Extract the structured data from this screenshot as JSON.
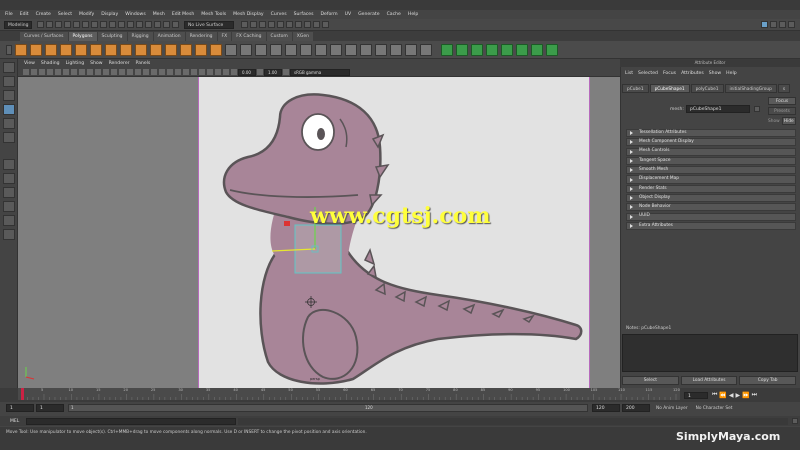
{
  "menubar": {
    "items": [
      "File",
      "Edit",
      "Create",
      "Select",
      "Modify",
      "Display",
      "Windows",
      "Mesh",
      "Edit Mesh",
      "Mesh Tools",
      "Mesh Display",
      "Curves",
      "Surfaces",
      "Deform",
      "UV",
      "Generate",
      "Cache",
      "Help"
    ]
  },
  "statusline": {
    "mode": "Modeling",
    "live_surface": "No Live Surface"
  },
  "shelf": {
    "tabs": [
      "Curves / Surfaces",
      "Polygons",
      "Sculpting",
      "Rigging",
      "Animation",
      "Rendering",
      "FX",
      "FX Caching",
      "Custom",
      "XGen"
    ],
    "active_tab": "Polygons"
  },
  "viewport": {
    "menu": [
      "View",
      "Shading",
      "Lighting",
      "Show",
      "Renderer",
      "Panels"
    ],
    "exposure": "0.00",
    "gamma": "1.00",
    "color_space": "sRGB gamma",
    "camera_label": "persp"
  },
  "watermark": "www.cgtsj.com",
  "attribute_editor": {
    "title": "Attribute Editor",
    "menu": [
      "List",
      "Selected",
      "Focus",
      "Attributes",
      "Show",
      "Help"
    ],
    "tabs": [
      "pCube1",
      "pCubeShape1",
      "polyCube1",
      "initialShadingGroup",
      "s"
    ],
    "active_tab": "pCubeShape1",
    "mesh_label": "mesh:",
    "mesh_value": "pCubeShape1",
    "focus_button": "Focus",
    "presets_button": "Presets",
    "show_label": "Show",
    "hide_button": "Hide",
    "sections": [
      "Tessellation Attributes",
      "Mesh Component Display",
      "Mesh Controls",
      "Tangent Space",
      "Smooth Mesh",
      "Displacement Map",
      "Render Stats",
      "Object Display",
      "Node Behavior",
      "UUID",
      "Extra Attributes"
    ],
    "notes_label": "Notes: pCubeShape1",
    "buttons": [
      "Select",
      "Load Attributes",
      "Copy Tab"
    ]
  },
  "timeline": {
    "ticks": [
      "5",
      "10",
      "15",
      "20",
      "25",
      "30",
      "35",
      "40",
      "45",
      "50",
      "55",
      "60",
      "65",
      "70",
      "75",
      "80",
      "85",
      "90",
      "95",
      "100",
      "105",
      "110",
      "115",
      "120"
    ],
    "current_frame": "1"
  },
  "range": {
    "start": "1",
    "playback_start": "1",
    "range_start_label": "1",
    "range_end_label": "120",
    "playback_end": "120",
    "end": "200",
    "anim_layer": "No Anim Layer",
    "character_set": "No Character Set"
  },
  "cmdline": {
    "label": "MEL"
  },
  "helpline": {
    "text": "Move Tool: Use manipulator to move object(s). Ctrl+MMB+drag to move components along normals. Use D or INSERT to change the pivot position and axis orientation."
  },
  "brand": "SimplyMaya.com",
  "colors": {
    "dino_fill": "#a88598",
    "dino_outline": "#5a5457",
    "film_gate": "#e2e2e2",
    "viewport_bg": "#7f7f7f",
    "watermark": "#ffff3c",
    "shelf_orange": "#d98b3a",
    "shelf_green": "#3b9c4a"
  }
}
